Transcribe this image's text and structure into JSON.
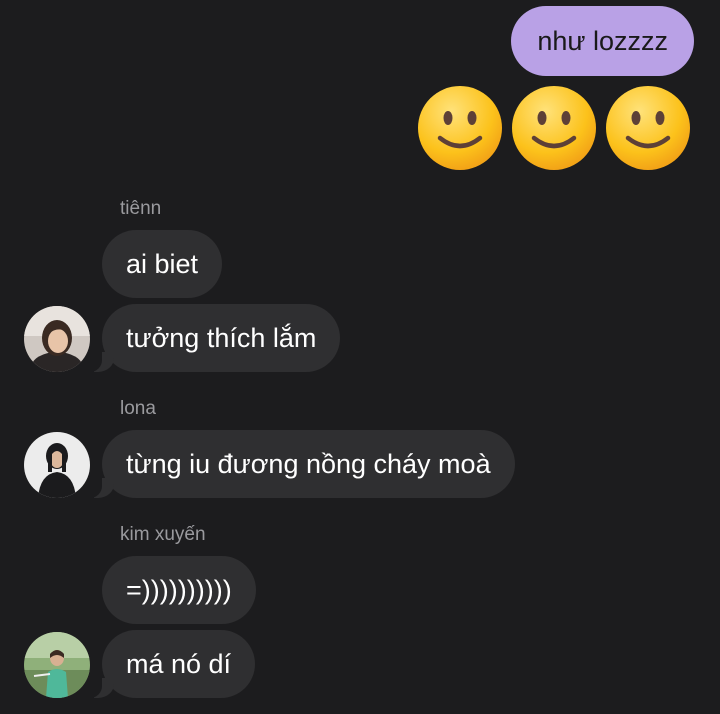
{
  "outgoing": {
    "text": "như lozzzz",
    "emoji_row": [
      "slightly-smiling-face",
      "slightly-smiling-face",
      "slightly-smiling-face"
    ],
    "bubble_color": "#b9a1e6"
  },
  "groups": [
    {
      "sender": "tiênn",
      "messages": [
        "ai biet",
        "tưởng thích lắm"
      ]
    },
    {
      "sender": "lona",
      "messages": [
        "từng iu đương nồng cháy moà"
      ]
    },
    {
      "sender": "kim xuyến",
      "messages": [
        "=))))))))))",
        "má nó dí"
      ]
    }
  ],
  "colors": {
    "background": "#1c1c1e",
    "incoming_bubble": "#2f2f31",
    "sender_name": "#9a9a9e"
  }
}
